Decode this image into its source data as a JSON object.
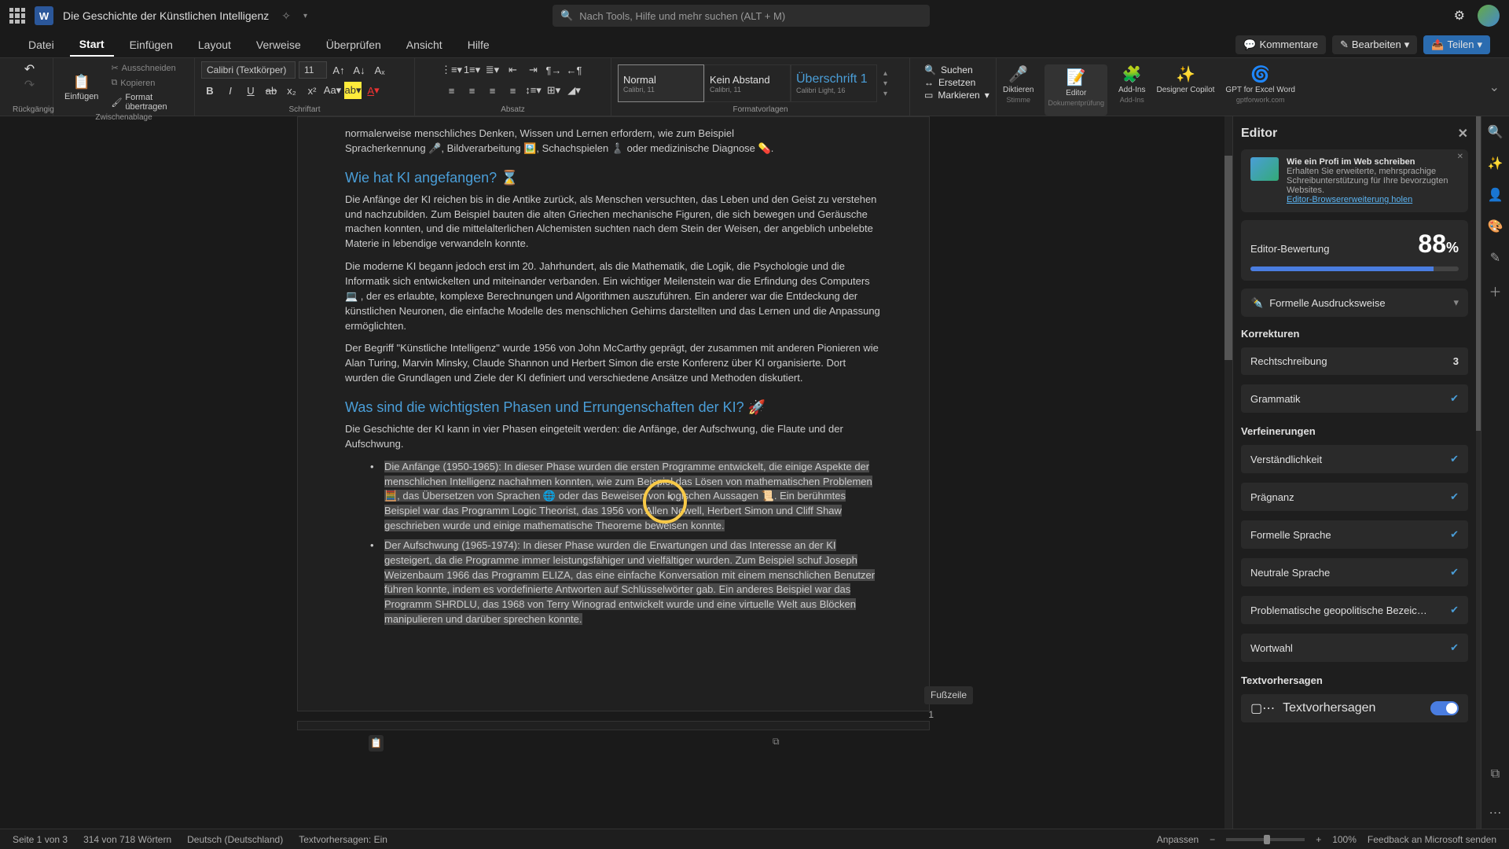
{
  "titlebar": {
    "doc_title": "Die Geschichte der Künstlichen Intelligenz",
    "search_placeholder": "Nach Tools, Hilfe und mehr suchen (ALT + M)"
  },
  "tabs": {
    "datei": "Datei",
    "start": "Start",
    "einfuegen": "Einfügen",
    "layout": "Layout",
    "verweise": "Verweise",
    "ueberpruefen": "Überprüfen",
    "ansicht": "Ansicht",
    "hilfe": "Hilfe",
    "kommentare": "Kommentare",
    "bearbeiten": "Bearbeiten",
    "teilen": "Teilen"
  },
  "ribbon": {
    "undo_label": "Rückgängig",
    "einfuegen_label": "Einfügen",
    "ausschneiden": "Ausschneiden",
    "kopieren": "Kopieren",
    "format_uebertragen": "Format übertragen",
    "zwischenablage": "Zwischenablage",
    "font_name": "Calibri (Textkörper)",
    "font_size": "11",
    "schriftart": "Schriftart",
    "absatz": "Absatz",
    "styles": {
      "normal": {
        "preview": "Normal",
        "sub": "Calibri, 11"
      },
      "kein_abstand": {
        "preview": "Kein Abstand",
        "sub": "Calibri, 11"
      },
      "ueberschrift": {
        "preview": "Überschrift 1",
        "sub": "Calibri Light, 16"
      }
    },
    "formatvorlagen": "Formatvorlagen",
    "suchen": "Suchen",
    "ersetzen": "Ersetzen",
    "markieren": "Markieren",
    "diktieren": "Diktieren",
    "stimme": "Stimme",
    "editor": "Editor",
    "dokumentpruefung": "Dokumentprüfung",
    "addins": "Add-Ins",
    "addins_label": "Add-Ins",
    "designer": "Designer Copilot",
    "gpt": "GPT for Excel Word",
    "gpt_site": "gptforwork.com"
  },
  "doc": {
    "p0a": "normalerweise menschliches Denken, Wissen und Lernen erfordern, wie zum Beispiel",
    "p0b": "Spracherkennung 🎤, Bildverarbeitung 🖼️, Schachspielen ♟️ oder medizinische Diagnose 💊.",
    "h1": "Wie hat KI angefangen? ⌛",
    "p1": "Die Anfänge der KI reichen bis in die Antike zurück, als Menschen versuchten, das Leben und den Geist zu verstehen und nachzubilden. Zum Beispiel bauten die alten Griechen mechanische Figuren, die sich bewegen und Geräusche machen konnten, und die mittelalterlichen Alchemisten suchten nach dem Stein der Weisen, der angeblich unbelebte Materie in lebendige verwandeln konnte.",
    "p2": "Die moderne KI begann jedoch erst im 20. Jahrhundert, als die Mathematik, die Logik, die Psychologie und die Informatik sich entwickelten und miteinander verbanden. Ein wichtiger Meilenstein war die Erfindung des Computers 💻 , der es erlaubte, komplexe Berechnungen und Algorithmen auszuführen. Ein anderer war die Entdeckung der künstlichen Neuronen, die einfache Modelle des menschlichen Gehirns darstellten und das Lernen und die Anpassung ermöglichten.",
    "p3": "Der Begriff \"Künstliche Intelligenz\" wurde 1956 von John McCarthy geprägt, der zusammen mit anderen Pionieren wie Alan Turing, Marvin Minsky, Claude Shannon und Herbert Simon die erste Konferenz über KI organisierte. Dort wurden die Grundlagen und Ziele der KI definiert und verschiedene Ansätze und Methoden diskutiert.",
    "h2": "Was sind die wichtigsten Phasen und Errungenschaften der KI? 🚀",
    "p4": "Die Geschichte der KI kann in vier Phasen eingeteilt werden: die Anfänge, der Aufschwung, die Flaute und der Aufschwung.",
    "b1": "Die Anfänge (1950-1965): In dieser Phase wurden die ersten Programme entwickelt, die einige Aspekte der menschlichen Intelligenz nachahmen konnten, wie zum Beispiel das Lösen von mathematischen Problemen 🧮, das Übersetzen von Sprachen 🌐 oder das Beweisen von logischen Aussagen 📜. Ein berühmtes Beispiel war das Programm Logic Theorist, das 1956 von Allen Newell, Herbert Simon und Cliff Shaw geschrieben wurde und einige mathematische Theoreme beweisen konnte.",
    "b2": "Der Aufschwung (1965-1974): In dieser Phase wurden die Erwartungen und das Interesse an der KI gesteigert, da die Programme immer leistungsfähiger und vielfältiger wurden. Zum Beispiel schuf Joseph Weizenbaum 1966 das Programm ELIZA, das eine einfache Konversation mit einem menschlichen Benutzer führen konnte, indem es vordefinierte Antworten auf Schlüsselwörter gab. Ein anderes Beispiel war das Programm SHRDLU, das 1968 von Terry Winograd entwickelt wurde und eine virtuelle Welt aus Blöcken manipulieren und darüber sprechen konnte.",
    "footer": "Fußzeile",
    "page_num": "1"
  },
  "editor_pane": {
    "title": "Editor",
    "promo_title": "Wie ein Profi im Web schreiben",
    "promo_body": "Erhalten Sie erweiterte, mehrsprachige Schreibunterstützung für Ihre bevorzugten Websites.",
    "promo_link": "Editor-Browsererweiterung holen",
    "score_label": "Editor-Bewertung",
    "score_value": "88",
    "score_pct": "%",
    "style_label": "Formelle Ausdrucksweise",
    "korrekturen": "Korrekturen",
    "rechtschreibung": "Rechtschreibung",
    "recht_count": "3",
    "grammatik": "Grammatik",
    "verfeinerungen": "Verfeinerungen",
    "verstaendlichkeit": "Verständlichkeit",
    "praegnanz": "Prägnanz",
    "formelle_sprache": "Formelle Sprache",
    "neutrale_sprache": "Neutrale Sprache",
    "problematisch": "Problematische geopolitische Bezeic…",
    "wortwahl": "Wortwahl",
    "textvorhersagen": "Textvorhersagen",
    "textvorhersagen_toggle": "Textvorhersagen"
  },
  "statusbar": {
    "page": "Seite 1 von 3",
    "words": "314 von 718 Wörtern",
    "lang": "Deutsch (Deutschland)",
    "predictions": "Textvorhersagen: Ein",
    "anpassen": "Anpassen",
    "zoom": "100%",
    "feedback": "Feedback an Microsoft senden"
  }
}
